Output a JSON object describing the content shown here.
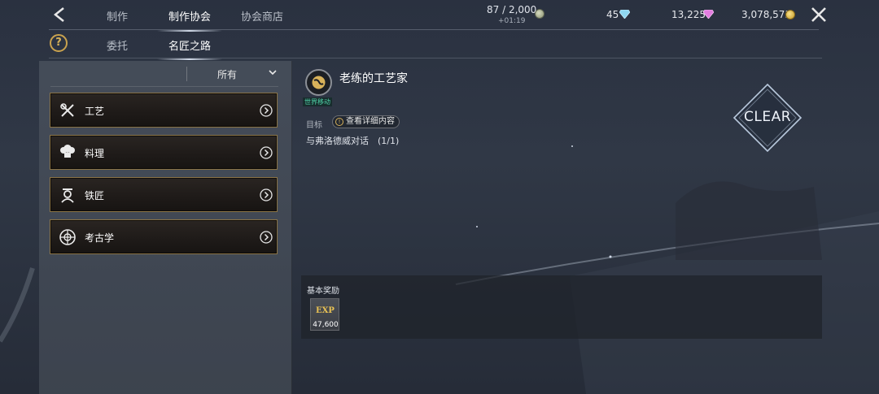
{
  "topbar": {
    "tabs": [
      "制作",
      "制作协会",
      "协会商店"
    ],
    "active_tab": "制作协会",
    "stamina": "87 / 2,000",
    "stamina_timer": "+01:19",
    "currencies": [
      {
        "icon": "energy-coin-icon",
        "value": "45",
        "icon_after": "blue-diamond-icon"
      },
      {
        "value": "13,225",
        "icon": "pink-diamond-icon"
      },
      {
        "value": "3,078,573",
        "icon": "gold-coin-icon"
      }
    ]
  },
  "subnav": {
    "tabs": [
      "委托",
      "名匠之路"
    ],
    "active_tab": "名匠之路"
  },
  "left_panel": {
    "filter_label": "所有",
    "categories": [
      {
        "label": "工艺",
        "icon": "tools-icon"
      },
      {
        "label": "料理",
        "icon": "chef-hat-icon"
      },
      {
        "label": "铁匠",
        "icon": "blacksmith-icon"
      },
      {
        "label": "考古学",
        "icon": "compass-icon"
      }
    ]
  },
  "quest": {
    "title": "老练的工艺家",
    "tag": "世界移动",
    "goal_label": "目标",
    "detail_button": "查看详细内容",
    "goal_text": "与弗洛德威对话　(1/1)",
    "status": "CLEAR"
  },
  "reward": {
    "title": "基本奖励",
    "icon_label": "EXP",
    "value": "47,600"
  },
  "colors": {
    "accent_gold": "#c9a24e",
    "tag_green": "#4fd3a8"
  }
}
